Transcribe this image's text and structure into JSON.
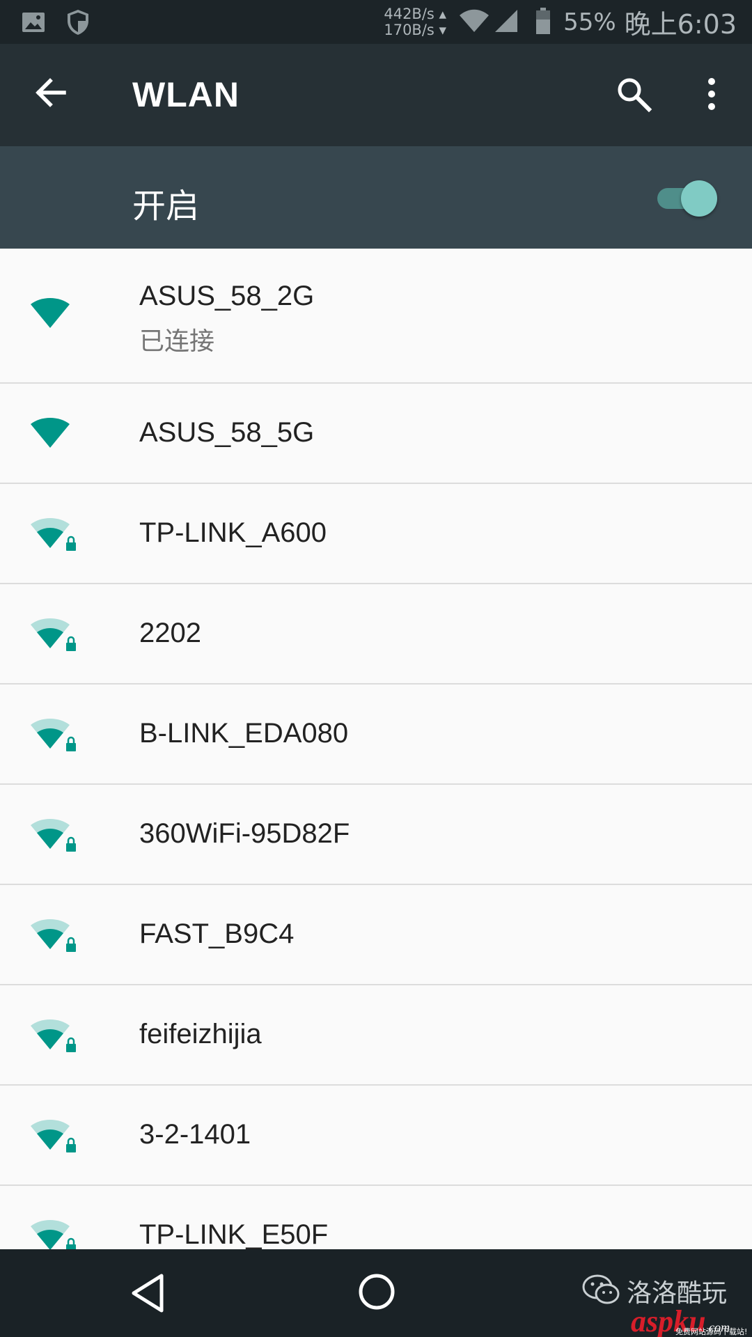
{
  "status_bar": {
    "upload_speed": "442B/s ▴",
    "download_speed": "170B/s ▾",
    "battery_percent": "55%",
    "time": "晚上6:03"
  },
  "toolbar": {
    "title": "WLAN"
  },
  "master_switch": {
    "label": "开启",
    "state": "on"
  },
  "networks": [
    {
      "name": "ASUS_58_2G",
      "status": "已连接",
      "secured": false,
      "signal": "full"
    },
    {
      "name": "ASUS_58_5G",
      "status": "",
      "secured": false,
      "signal": "full"
    },
    {
      "name": "TP-LINK_A600",
      "status": "",
      "secured": true,
      "signal": "medium"
    },
    {
      "name": "2202",
      "status": "",
      "secured": true,
      "signal": "medium"
    },
    {
      "name": "B-LINK_EDA080",
      "status": "",
      "secured": true,
      "signal": "medium"
    },
    {
      "name": "360WiFi-95D82F",
      "status": "",
      "secured": true,
      "signal": "medium"
    },
    {
      "name": "FAST_B9C4",
      "status": "",
      "secured": true,
      "signal": "medium"
    },
    {
      "name": "feifeizhijia",
      "status": "",
      "secured": true,
      "signal": "medium"
    },
    {
      "name": "3-2-1401",
      "status": "",
      "secured": true,
      "signal": "medium"
    },
    {
      "name": "TP-LINK_E50F",
      "status": "",
      "secured": true,
      "signal": "medium"
    }
  ],
  "watermark": {
    "channel": "洛洛酷玩",
    "logo": "aspku",
    "logo_suffix": ".com",
    "tagline": "免费网站源码下载站!"
  },
  "colors": {
    "accent": "#009688",
    "accent_light": "#b2dfdb",
    "toolbar": "#263035",
    "switch_bar": "#37474f"
  }
}
